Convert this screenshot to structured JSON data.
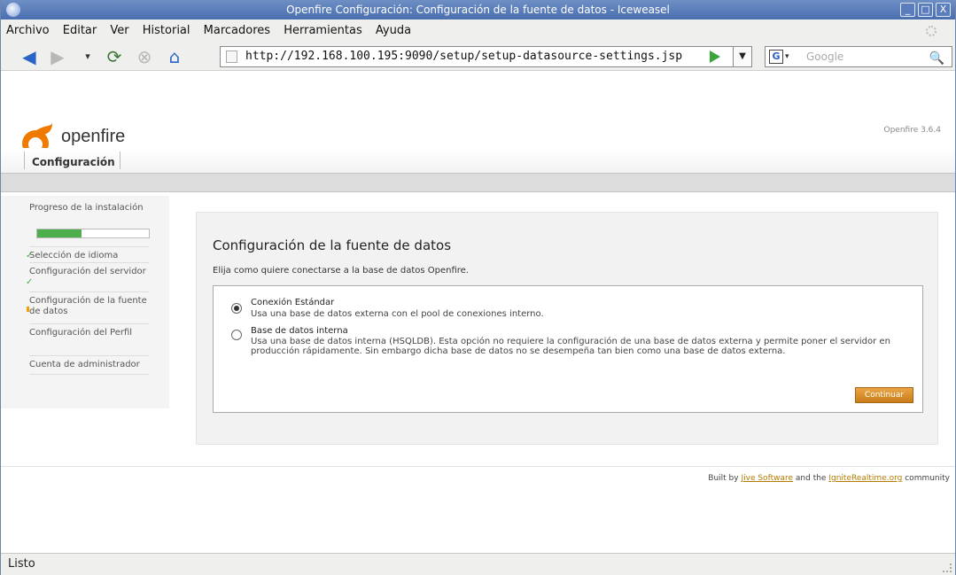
{
  "window": {
    "title": "Openfire Configuración: Configuración de la fuente de datos - Iceweasel",
    "minimize": "_",
    "maximize": "□",
    "close": "X"
  },
  "menu": [
    "Archivo",
    "Editar",
    "Ver",
    "Historial",
    "Marcadores",
    "Herramientas",
    "Ayuda"
  ],
  "nav": {
    "url": "http://192.168.100.195:9090/setup/setup-datasource-settings.jsp",
    "search_placeholder": "Google"
  },
  "header": {
    "logo_text": "openfire",
    "version": "Openfire 3.6.4",
    "tab": "Configuración"
  },
  "sidebar": {
    "title": "Progreso de la instalación",
    "progress": 0.4,
    "items": [
      {
        "label": "Selección de idioma",
        "state": "done"
      },
      {
        "label": "Configuración del servidor",
        "state": "done"
      },
      {
        "label": "Configuración de la fuente de datos",
        "state": "current"
      },
      {
        "label": "Configuración del Perfil",
        "state": "pending"
      },
      {
        "label": "Cuenta de administrador",
        "state": "pending"
      }
    ]
  },
  "main": {
    "heading": "Configuración de la fuente de datos",
    "intro": "Elija como quiere conectarse a la base de datos Openfire.",
    "options": [
      {
        "title": "Conexión Estándar",
        "desc": "Usa una base de datos externa con el pool de conexiones interno.",
        "selected": true
      },
      {
        "title": "Base de datos interna",
        "desc": "Usa una base de datos interna (HSQLDB). Esta opción no requiere la configuración de una base de datos externa y permite poner el servidor en producción rápidamente. Sin embargo dicha base de datos no se desempeña tan bien como una base de datos externa.",
        "selected": false
      }
    ],
    "continue_label": "Continuar"
  },
  "footer": {
    "built_by": "Built by",
    "jive": "Jive Software",
    "and_the": "and the",
    "ignite": "IgniteRealtime.org",
    "community": "community"
  },
  "status": "Listo",
  "colors": {
    "progress_fill": "#4cae4c",
    "button": "#d98f2a",
    "link": "#b57b00"
  }
}
